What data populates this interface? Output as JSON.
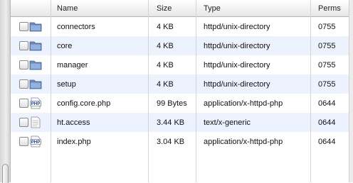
{
  "columns": {
    "name": "Name",
    "size": "Size",
    "type": "Type",
    "perms": "Perms"
  },
  "files": [
    {
      "icon": "folder-icon",
      "name": "connectors",
      "size": "4 KB",
      "type": "httpd/unix-directory",
      "perms": "0755"
    },
    {
      "icon": "folder-icon",
      "name": "core",
      "size": "4 KB",
      "type": "httpd/unix-directory",
      "perms": "0755"
    },
    {
      "icon": "folder-icon",
      "name": "manager",
      "size": "4 KB",
      "type": "httpd/unix-directory",
      "perms": "0755"
    },
    {
      "icon": "folder-icon",
      "name": "setup",
      "size": "4 KB",
      "type": "httpd/unix-directory",
      "perms": "0755"
    },
    {
      "icon": "php-file-icon",
      "name": "config.core.php",
      "size": "99 Bytes",
      "type": "application/x-httpd-php",
      "perms": "0644"
    },
    {
      "icon": "text-file-icon",
      "name": "ht.access",
      "size": "3.44 KB",
      "type": "text/x-generic",
      "perms": "0644"
    },
    {
      "icon": "php-file-icon",
      "name": "index.php",
      "size": "3.04 KB",
      "type": "application/x-httpd-php",
      "perms": "0644"
    }
  ],
  "icon_labels": {
    "php": "PHP"
  }
}
